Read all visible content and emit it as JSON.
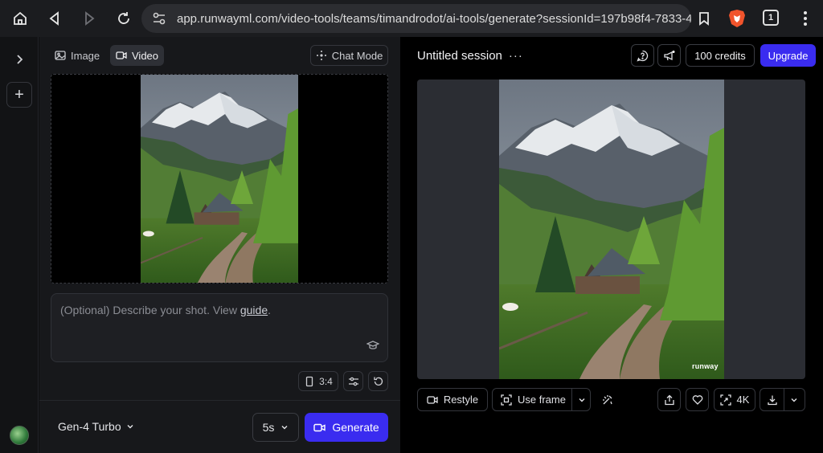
{
  "browser": {
    "url": "app.runwayml.com/video-tools/teams/timandrodot/ai-tools/generate?sessionId=197b98f4-7833-48",
    "tab_count": "1"
  },
  "panel": {
    "tabs": [
      {
        "label": "Image",
        "icon": "image-icon",
        "active": false
      },
      {
        "label": "Video",
        "icon": "video-icon",
        "active": true
      }
    ],
    "chat_mode_label": "Chat Mode",
    "prompt": {
      "placeholder": "(Optional) Describe your shot. View ",
      "guide_link": "guide",
      "suffix": "."
    },
    "aspect_ratio": "3:4",
    "model": "Gen-4 Turbo",
    "duration": "5s",
    "generate_label": "Generate"
  },
  "stage": {
    "session_title": "Untitled session",
    "credits": "100 credits",
    "upgrade_label": "Upgrade",
    "watermark": "runway",
    "actions": {
      "restyle": "Restyle",
      "use_frame": "Use frame",
      "upscale": "4K"
    }
  },
  "colors": {
    "accent": "#3a2cf0",
    "panel_bg": "#17181b",
    "stage_bg": "#000000",
    "preview_bg": "#2b2d33"
  }
}
